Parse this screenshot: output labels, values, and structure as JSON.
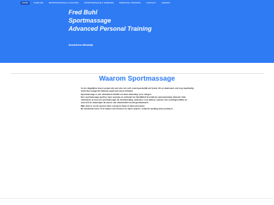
{
  "nav": {
    "items": [
      "HOME",
      "OVER MIJ",
      "SPORTMASSAGE & LOCATIES",
      "SPORTMASSAGE & TARIEVEN",
      "PERSONAL TRAINING",
      "CONTACT",
      "AGENDA"
    ],
    "active_index": 0
  },
  "hero": {
    "title_line1": "Fred Buhl",
    "title_line2": "Sportmassage",
    "title_line3": "Advanced Personal Training",
    "location": "Amstelveen-Westwijk",
    "background_color": "#2f7bf4"
  },
  "main": {
    "section_title": "Waarom Sportmassage",
    "paragraphs": [
      "In ons dagelijkse leven vergen wij veel van ons zelf, zowel geestelijk als fysiek. Als je daarnaast ook nog regelmatig traint dan vraagt dit training nogal wat van je lichaam.",
      "Sportmassage is een uitstekend middel om deze belasting op te vangen.",
      "Een sportmassage geeft je meer energie en verbetert de flexibiliteit doordat de spierspanning afneemt. Ook stimuleren je met een sportmassage de doorbloeding, waardoor voor tijdens sporten van voedingsstoffen en zuurstof en andersijds de afvoer van afvalstoffen wordt gestimuleerd.",
      "Mijn doel is om de sporter (dus ook jij) en beter te laten presteren.",
      "De werkende mens of te helpen van dromen en stijve spieren, zodat de werking weer prettig is."
    ]
  }
}
